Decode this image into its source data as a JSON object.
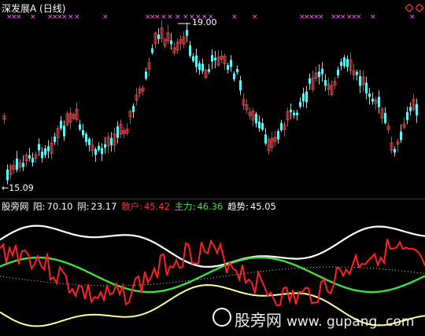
{
  "chart_title": "深发展A (日线)",
  "high_label": "19.00",
  "low_label": "←15.09",
  "indicator": {
    "name": "股旁网",
    "yang_label": "阳:",
    "yang_value": "70.10",
    "yin_label": "阴:",
    "yin_value": "23.17",
    "sanhu_label": "散户:",
    "sanhu_value": "45.42",
    "zhuli_label": "主力:",
    "zhuli_value": "46.36",
    "qushi_label": "趋势:",
    "qushi_value": "45.05"
  },
  "watermark": {
    "name": "股旁网",
    "url": "www. gupang. com"
  },
  "colors": {
    "up": "#ff3232",
    "down": "#54fcfc",
    "yang": "#ffffff",
    "yin": "#ffff99",
    "sanhu": "#ff2020",
    "zhuli": "#40e040",
    "qushi": "#d8d8d8",
    "marker": "#ff66ff",
    "sep": "#b00000"
  },
  "icons": [
    "diamond-icon",
    "diamond-icon"
  ],
  "chart_data": {
    "type": "candlestick",
    "title": "深发展A (日线)",
    "price_high": 19.0,
    "price_low": 15.09,
    "indicator_values": {
      "阳": 70.1,
      "阴": 23.17,
      "散户": 45.42,
      "主力": 46.36,
      "趋势": 45.05
    }
  }
}
